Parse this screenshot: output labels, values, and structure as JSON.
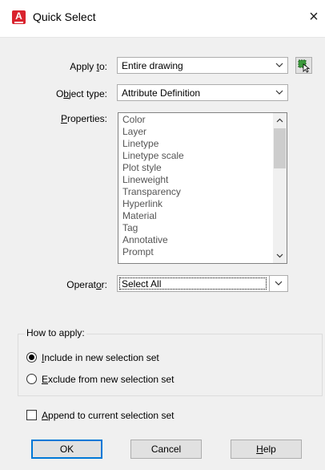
{
  "window": {
    "title": "Quick Select",
    "app_icon_letter": "A",
    "close_glyph": "×"
  },
  "apply_to": {
    "label_pre": "Apply ",
    "label_u": "t",
    "label_post": "o:",
    "value": "Entire drawing",
    "select_objects_icon": "select-objects-icon"
  },
  "object_type": {
    "label_pre": "O",
    "label_u": "b",
    "label_post": "ject type:",
    "value": "Attribute Definition"
  },
  "properties": {
    "label_pre": "",
    "label_u": "P",
    "label_post": "roperties:",
    "items": [
      "Color",
      "Layer",
      "Linetype",
      "Linetype scale",
      "Plot style",
      "Lineweight",
      "Transparency",
      "Hyperlink",
      "Material",
      "Tag",
      "Annotative",
      "Prompt"
    ]
  },
  "operator": {
    "label_pre": "Operat",
    "label_u": "o",
    "label_post": "r:",
    "value": "Select All"
  },
  "how_to_apply": {
    "title": "How to apply:",
    "include": {
      "pre": "",
      "u": "I",
      "post": "nclude in new selection set",
      "selected": true
    },
    "exclude": {
      "pre": "",
      "u": "E",
      "post": "xclude from new selection set",
      "selected": false
    }
  },
  "append": {
    "pre": "",
    "u": "A",
    "post": "ppend to current selection set",
    "checked": false
  },
  "buttons": {
    "ok": "OK",
    "cancel": "Cancel",
    "help_u": "H",
    "help_post": "elp"
  },
  "colors": {
    "accent": "#0078d7",
    "autocad_red": "#d9232e"
  }
}
